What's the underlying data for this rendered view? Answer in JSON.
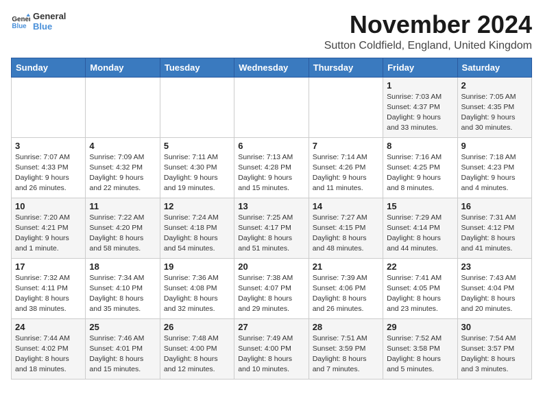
{
  "logo": {
    "general": "General",
    "blue": "Blue"
  },
  "title": "November 2024",
  "location": "Sutton Coldfield, England, United Kingdom",
  "days_of_week": [
    "Sunday",
    "Monday",
    "Tuesday",
    "Wednesday",
    "Thursday",
    "Friday",
    "Saturday"
  ],
  "weeks": [
    [
      {
        "day": "",
        "info": ""
      },
      {
        "day": "",
        "info": ""
      },
      {
        "day": "",
        "info": ""
      },
      {
        "day": "",
        "info": ""
      },
      {
        "day": "",
        "info": ""
      },
      {
        "day": "1",
        "info": "Sunrise: 7:03 AM\nSunset: 4:37 PM\nDaylight: 9 hours and 33 minutes."
      },
      {
        "day": "2",
        "info": "Sunrise: 7:05 AM\nSunset: 4:35 PM\nDaylight: 9 hours and 30 minutes."
      }
    ],
    [
      {
        "day": "3",
        "info": "Sunrise: 7:07 AM\nSunset: 4:33 PM\nDaylight: 9 hours and 26 minutes."
      },
      {
        "day": "4",
        "info": "Sunrise: 7:09 AM\nSunset: 4:32 PM\nDaylight: 9 hours and 22 minutes."
      },
      {
        "day": "5",
        "info": "Sunrise: 7:11 AM\nSunset: 4:30 PM\nDaylight: 9 hours and 19 minutes."
      },
      {
        "day": "6",
        "info": "Sunrise: 7:13 AM\nSunset: 4:28 PM\nDaylight: 9 hours and 15 minutes."
      },
      {
        "day": "7",
        "info": "Sunrise: 7:14 AM\nSunset: 4:26 PM\nDaylight: 9 hours and 11 minutes."
      },
      {
        "day": "8",
        "info": "Sunrise: 7:16 AM\nSunset: 4:25 PM\nDaylight: 9 hours and 8 minutes."
      },
      {
        "day": "9",
        "info": "Sunrise: 7:18 AM\nSunset: 4:23 PM\nDaylight: 9 hours and 4 minutes."
      }
    ],
    [
      {
        "day": "10",
        "info": "Sunrise: 7:20 AM\nSunset: 4:21 PM\nDaylight: 9 hours and 1 minute."
      },
      {
        "day": "11",
        "info": "Sunrise: 7:22 AM\nSunset: 4:20 PM\nDaylight: 8 hours and 58 minutes."
      },
      {
        "day": "12",
        "info": "Sunrise: 7:24 AM\nSunset: 4:18 PM\nDaylight: 8 hours and 54 minutes."
      },
      {
        "day": "13",
        "info": "Sunrise: 7:25 AM\nSunset: 4:17 PM\nDaylight: 8 hours and 51 minutes."
      },
      {
        "day": "14",
        "info": "Sunrise: 7:27 AM\nSunset: 4:15 PM\nDaylight: 8 hours and 48 minutes."
      },
      {
        "day": "15",
        "info": "Sunrise: 7:29 AM\nSunset: 4:14 PM\nDaylight: 8 hours and 44 minutes."
      },
      {
        "day": "16",
        "info": "Sunrise: 7:31 AM\nSunset: 4:12 PM\nDaylight: 8 hours and 41 minutes."
      }
    ],
    [
      {
        "day": "17",
        "info": "Sunrise: 7:32 AM\nSunset: 4:11 PM\nDaylight: 8 hours and 38 minutes."
      },
      {
        "day": "18",
        "info": "Sunrise: 7:34 AM\nSunset: 4:10 PM\nDaylight: 8 hours and 35 minutes."
      },
      {
        "day": "19",
        "info": "Sunrise: 7:36 AM\nSunset: 4:08 PM\nDaylight: 8 hours and 32 minutes."
      },
      {
        "day": "20",
        "info": "Sunrise: 7:38 AM\nSunset: 4:07 PM\nDaylight: 8 hours and 29 minutes."
      },
      {
        "day": "21",
        "info": "Sunrise: 7:39 AM\nSunset: 4:06 PM\nDaylight: 8 hours and 26 minutes."
      },
      {
        "day": "22",
        "info": "Sunrise: 7:41 AM\nSunset: 4:05 PM\nDaylight: 8 hours and 23 minutes."
      },
      {
        "day": "23",
        "info": "Sunrise: 7:43 AM\nSunset: 4:04 PM\nDaylight: 8 hours and 20 minutes."
      }
    ],
    [
      {
        "day": "24",
        "info": "Sunrise: 7:44 AM\nSunset: 4:02 PM\nDaylight: 8 hours and 18 minutes."
      },
      {
        "day": "25",
        "info": "Sunrise: 7:46 AM\nSunset: 4:01 PM\nDaylight: 8 hours and 15 minutes."
      },
      {
        "day": "26",
        "info": "Sunrise: 7:48 AM\nSunset: 4:00 PM\nDaylight: 8 hours and 12 minutes."
      },
      {
        "day": "27",
        "info": "Sunrise: 7:49 AM\nSunset: 4:00 PM\nDaylight: 8 hours and 10 minutes."
      },
      {
        "day": "28",
        "info": "Sunrise: 7:51 AM\nSunset: 3:59 PM\nDaylight: 8 hours and 7 minutes."
      },
      {
        "day": "29",
        "info": "Sunrise: 7:52 AM\nSunset: 3:58 PM\nDaylight: 8 hours and 5 minutes."
      },
      {
        "day": "30",
        "info": "Sunrise: 7:54 AM\nSunset: 3:57 PM\nDaylight: 8 hours and 3 minutes."
      }
    ]
  ]
}
